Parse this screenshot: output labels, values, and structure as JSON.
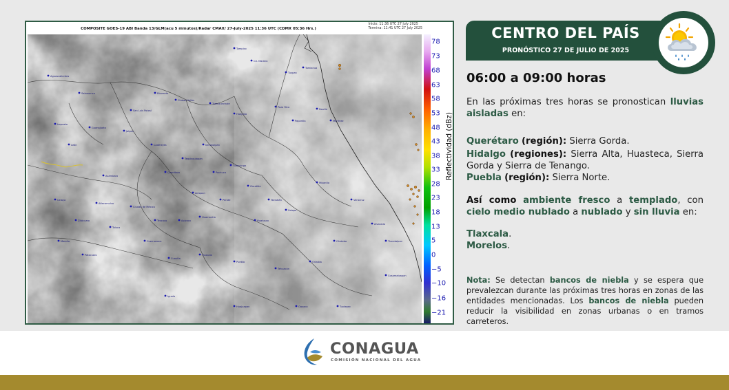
{
  "satellite": {
    "header_title": "COMPOSITE GOES-19 ABI Banda 13/GLM(acu 5 minutos)/Radar CMAX/ 27-July-2025 11:36 UTC  (CDMX  05:36 Hrs.)",
    "start_time": "Inicio: 11:36 UTC 27 July 2025",
    "end_time": "Termina: 11:41 UTC 27 July 2025",
    "colorbar_label": "Reflectividad (dBz)",
    "colorbar_ticks": [
      "78",
      "73",
      "68",
      "63",
      "58",
      "53",
      "48",
      "43",
      "38",
      "33",
      "28",
      "23",
      "18",
      "13",
      "5",
      "0",
      "−5",
      "−10",
      "−16",
      "−21"
    ],
    "city_labels": [
      "Tampico",
      "Ciudad Valles",
      "Tamazunchale",
      "Tuxpan",
      "Poza Rica",
      "Xalapa",
      "Veracruz",
      "Pachuca",
      "Querétaro",
      "Guanajuato",
      "Morelia",
      "Toluca",
      "Cuernavaca",
      "Puebla",
      "Tlaxcala",
      "Tehuacán",
      "Orizaba",
      "Córdoba",
      "Chilpancingo",
      "Acapulco",
      "Oaxaca",
      "Iguala",
      "Taxco",
      "Cuautla",
      "Celaya",
      "León",
      "Irapuato",
      "Zacatecas",
      "Aguascalientes",
      "San Luis Potosí",
      "Lagos de Moreno",
      "Uruapan",
      "Zitácuaro",
      "Huajuapan",
      "Tlapa",
      "Atlacomulco",
      "Apizaco",
      "Tulancingo",
      "Teziutlán",
      "Perote",
      "Martínez",
      "Papantla",
      "Coatzintla",
      "Naolinco",
      "Huatusco",
      "Tierra Blanca",
      "Cosamaloapan",
      "Alvarado",
      "Boca del Río",
      "Lerma",
      "Ciudad de México",
      "Zihuatanejo",
      "Lázaro Cárdenas",
      "Pátzcuaro",
      "Salamanca",
      "Apatzingán",
      "Tecpan",
      "Ometepec",
      "Pinotepa",
      "Puerto Escondido",
      "Tuxtepec",
      "Juchitán",
      "Miahuatlán",
      "Zaachila"
    ]
  },
  "header": {
    "title": "CENTRO DEL PAÍS",
    "subtitle": "PRONÓSTICO 27 DE JULIO DE 2025",
    "icon": "sun-cloud-rain-icon"
  },
  "forecast": {
    "time_range": "06:00 a 09:00 horas",
    "intro_a": "En las próximas tres horas se pronostican",
    "intro_highlight": "lluvias aisladas",
    "intro_b": "en:",
    "regions": [
      {
        "state": "Querétaro",
        "kind": "(región):",
        "places": "Sierra Gorda."
      },
      {
        "state": "Hidalgo",
        "kind": "(regiones):",
        "places": "Sierra Alta, Huasteca, Sierra Gorda y  Sierra de Tenango."
      },
      {
        "state": "Puebla",
        "kind": "(región):",
        "places": "Sierra Norte."
      }
    ],
    "also_lead": "Así como",
    "also_w1": "ambiente fresco",
    "also_t1": "a",
    "also_w2": "templado",
    "also_t2": ", con",
    "also_w3": "cielo medio nublado",
    "also_t3": "a",
    "also_w4": "nublado",
    "also_t4": "y",
    "also_w5": "sin lluvia",
    "also_t5": "en:",
    "states2": [
      "Tlaxcala",
      "Morelos"
    ],
    "note_label": "Nota:",
    "note_a": "Se detectan",
    "note_h1": "bancos de niebla",
    "note_b": "y se espera que prevalezcan durante las próximas tres horas en zonas de las entidades mencionadas. Los",
    "note_h2": "bancos de niebla",
    "note_c": "pueden reducir la visibilidad en zonas urbanas o en tramos carreteros."
  },
  "footer": {
    "logo_name": "CONAGUA",
    "logo_subtitle": "COMISIÓN NACIONAL DEL AGUA",
    "logo_icon": "conagua-logo-icon",
    "bar_color": "#a48a2e"
  },
  "colors": {
    "brand_green": "#23503c",
    "highlight_green": "#2c5a44"
  }
}
